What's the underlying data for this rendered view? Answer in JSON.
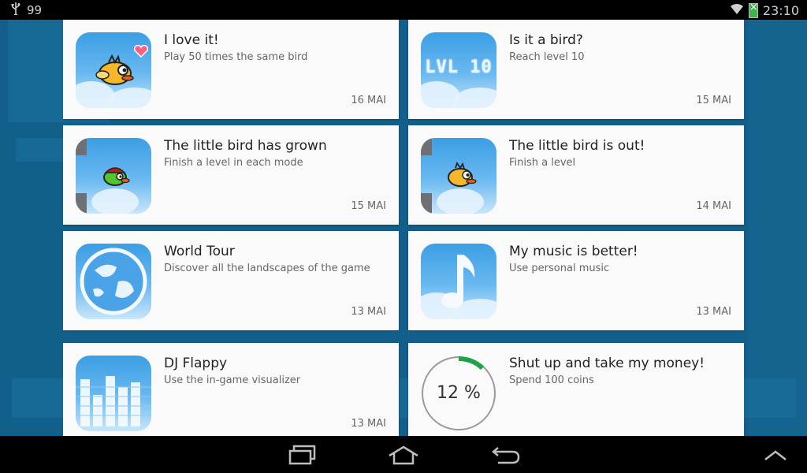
{
  "statusbar": {
    "notification_count": "99",
    "time": "23:10"
  },
  "achievements": [
    {
      "title": "I love it!",
      "description": "Play 50 times the same bird",
      "date": "16 MAI",
      "icon": "bird-heart-icon"
    },
    {
      "title": "Is it a bird?",
      "description": "Reach level 10",
      "date": "15 MAI",
      "icon": "level-10-icon",
      "icon_text": "LVL 10"
    },
    {
      "title": "The little bird has grown",
      "description": "Finish a level in each mode",
      "date": "15 MAI",
      "icon": "green-bird-icon"
    },
    {
      "title": "The little bird is out!",
      "description": "Finish a level",
      "date": "14 MAI",
      "icon": "yellow-bird-icon"
    },
    {
      "title": "World Tour",
      "description": "Discover all the landscapes of the game",
      "date": "13 MAI",
      "icon": "globe-icon"
    },
    {
      "title": "My music is better!",
      "description": "Use personal music",
      "date": "13 MAI",
      "icon": "music-note-icon"
    },
    {
      "title": "DJ Flappy",
      "description": "Use the in-game visualizer",
      "date": "13 MAI",
      "icon": "equalizer-icon"
    },
    {
      "title": "Shut up and take my money!",
      "description": "Spend 100 coins",
      "date": "",
      "icon": "progress-ring",
      "progress_label": "12 %",
      "progress": 0.12
    }
  ],
  "colors": {
    "progress_fill": "#1fa34a",
    "progress_track": "#9a9a9a",
    "card": "#fafafa"
  }
}
